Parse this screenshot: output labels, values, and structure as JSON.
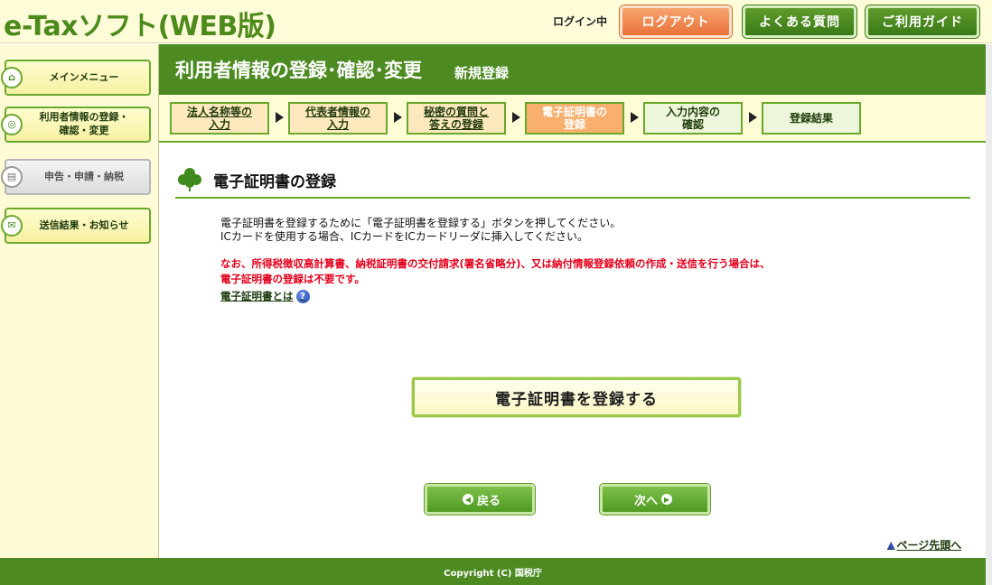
{
  "header": {
    "logo": "e-Taxソフト(WEB版)",
    "login_status": "ログイン中",
    "logout": "ログアウト",
    "faq": "よくある質問",
    "guide": "ご利用ガイド"
  },
  "sidebar": {
    "items": [
      {
        "label": "メインメニュー",
        "icon": "home-icon",
        "state": "active"
      },
      {
        "label": "利用者情報の登録・\n確認・変更",
        "icon": "user-info-icon",
        "state": "active"
      },
      {
        "label": "申告・申請・納税",
        "icon": "document-icon",
        "state": "disabled"
      },
      {
        "label": "送信結果・お知らせ",
        "icon": "mail-icon",
        "state": "active"
      }
    ]
  },
  "title_bar": {
    "title": "利用者情報の登録･確認･変更",
    "subtitle": "新規登録"
  },
  "steps": [
    {
      "label": "法人名称等の\n入力",
      "state": "done"
    },
    {
      "label": "代表者情報の\n入力",
      "state": "done"
    },
    {
      "label": "秘密の質問と\n答えの登録",
      "state": "done"
    },
    {
      "label": "電子証明書の\n登録",
      "state": "current"
    },
    {
      "label": "入力内容の\n確認",
      "state": "pending"
    },
    {
      "label": "登録結果",
      "state": "pending"
    }
  ],
  "content": {
    "section_title": "電子証明書の登録",
    "desc_line1": "電子証明書を登録するために「電子証明書を登録する」ボタンを押してください。",
    "desc_line2": "ICカードを使用する場合、ICカードをICカードリーダに挿入してください。",
    "note_line1": "なお、所得税徴収高計算書、納税証明書の交付請求(署名省略分)、又は納付情報登録依頼の作成・送信を行う場合は、",
    "note_line2": "電子証明書の登録は不要です。",
    "about_link": "電子証明書とは",
    "register_button": "電子証明書を登録する",
    "back_button": "戻る",
    "next_button": "次へ",
    "top_link": "ページ先頭へ"
  },
  "footer": {
    "copyright": "Copyright (C) 国税庁"
  },
  "colors": {
    "brand_green": "#4d8b22",
    "cream": "#fffcd6",
    "note_red": "#e4001c",
    "logout_orange": "#e8733a"
  }
}
